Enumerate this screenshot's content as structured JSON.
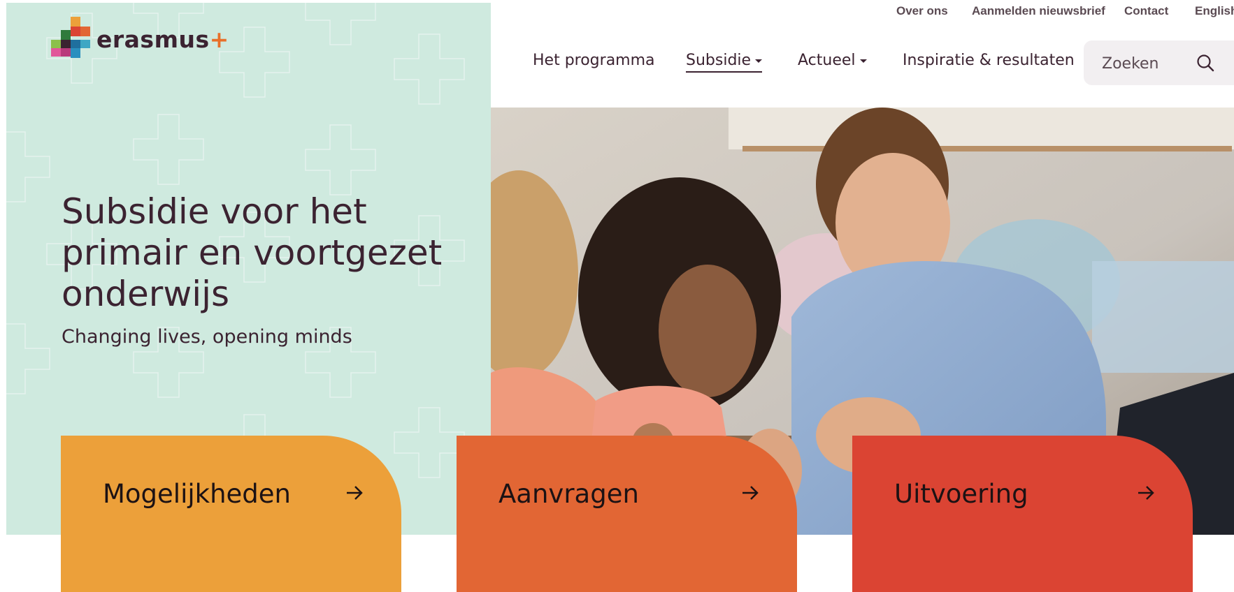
{
  "brand": {
    "name": "erasmus",
    "plus": "+",
    "colors": {
      "panel": "#cfeadf",
      "text": "#3b2331",
      "orange": "#eca03a",
      "orange_red": "#e26634",
      "red": "#db4433"
    }
  },
  "top_links": [
    {
      "label": "Over ons"
    },
    {
      "label": "Aanmelden nieuwsbrief"
    },
    {
      "label": "Contact"
    },
    {
      "label": "English"
    }
  ],
  "main_nav": [
    {
      "label": "Het programma",
      "has_dropdown": false
    },
    {
      "label": "Subsidie",
      "has_dropdown": true,
      "active": true
    },
    {
      "label": "Actueel",
      "has_dropdown": true
    },
    {
      "label": "Inspiratie & resultaten",
      "has_dropdown": false
    }
  ],
  "search": {
    "placeholder": "Zoeken",
    "icon": "search-icon"
  },
  "hero": {
    "title": "Subsidie voor het primair en voortgezet onderwijs",
    "subtitle": "Changing lives, opening minds"
  },
  "cards": [
    {
      "label": "Mogelijkheden",
      "color": "#eca03a",
      "icon": "arrow-right-icon"
    },
    {
      "label": "Aanvragen",
      "color": "#e26634",
      "icon": "arrow-right-icon"
    },
    {
      "label": "Uitvoering",
      "color": "#db4433",
      "icon": "arrow-right-icon"
    }
  ]
}
